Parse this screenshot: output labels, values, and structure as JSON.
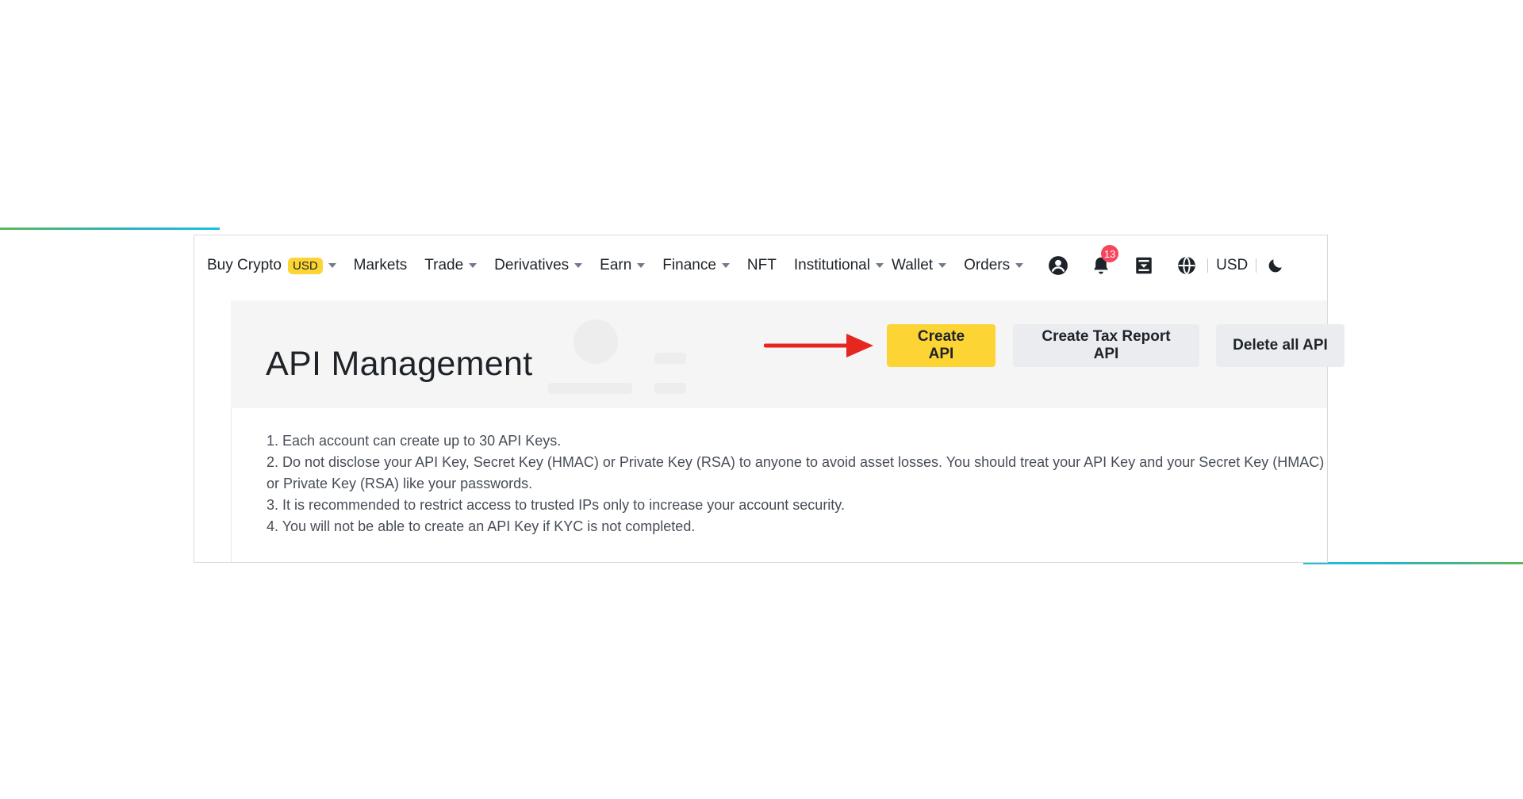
{
  "nav": {
    "items": [
      {
        "label": "Buy Crypto",
        "badge": "USD",
        "has_caret": true
      },
      {
        "label": "Markets",
        "has_caret": false
      },
      {
        "label": "Trade",
        "has_caret": true
      },
      {
        "label": "Derivatives",
        "has_caret": true
      },
      {
        "label": "Earn",
        "has_caret": true
      },
      {
        "label": "Finance",
        "has_caret": true
      },
      {
        "label": "NFT",
        "has_caret": false
      },
      {
        "label": "Institutional",
        "has_caret": true
      },
      {
        "label": "Wallet",
        "has_caret": true
      },
      {
        "label": "Orders",
        "has_caret": true
      }
    ],
    "icons": [
      "user-icon",
      "bell-icon",
      "download-icon",
      "globe-icon",
      "moon-icon"
    ],
    "notification_count": "13",
    "currency": "USD"
  },
  "header": {
    "title": "API Management",
    "buttons": {
      "create": "Create API",
      "tax": "Create Tax Report API",
      "delete": "Delete all API"
    }
  },
  "notes": [
    "1. Each account can create up to 30 API Keys.",
    "2. Do not disclose your API Key, Secret Key (HMAC) or Private Key (RSA) to anyone to avoid asset losses. You should treat your API Key and your Secret Key (HMAC) or Private Key (RSA) like your passwords.",
    "3. It is recommended to restrict access to trusted IPs only to increase your account security.",
    "4. You will not be able to create an API Key if KYC is not completed."
  ],
  "colors": {
    "primary_button": "#fcd535",
    "secondary_button": "#eaecef",
    "badge_red": "#f6465d",
    "arrow_red": "#e5271f",
    "header_bg": "#f5f5f5",
    "text": "#1e2329"
  }
}
